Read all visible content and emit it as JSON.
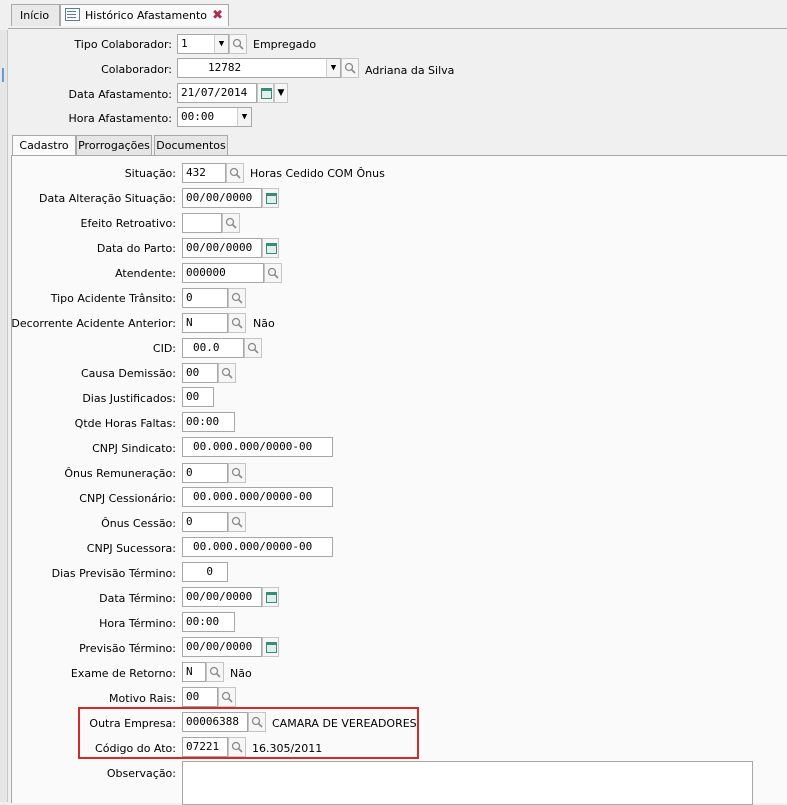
{
  "tabs": {
    "home": "Início",
    "current": "Histórico Afastamento"
  },
  "header": {
    "tipo_colaborador": {
      "label": "Tipo Colaborador:",
      "value": "1",
      "desc": "Empregado"
    },
    "colaborador": {
      "label": "Colaborador:",
      "value": "12782",
      "desc": "Adriana da Silva"
    },
    "data_afastamento": {
      "label": "Data Afastamento:",
      "value": "21/07/2014"
    },
    "hora_afastamento": {
      "label": "Hora Afastamento:",
      "value": "00:00"
    }
  },
  "subtabs": [
    "Cadastro",
    "Prorrogações",
    "Documentos"
  ],
  "form": {
    "situacao": {
      "label": "Situação:",
      "value": "432",
      "desc": "Horas Cedido COM Ônus"
    },
    "data_alteracao_situacao": {
      "label": "Data Alteração Situação:",
      "value": "00/00/0000"
    },
    "efeito_retroativo": {
      "label": "Efeito Retroativo:",
      "value": ""
    },
    "data_parto": {
      "label": "Data do Parto:",
      "value": "00/00/0000"
    },
    "atendente": {
      "label": "Atendente:",
      "value": "000000"
    },
    "tipo_acidente_transito": {
      "label": "Tipo Acidente Trânsito:",
      "value": "0"
    },
    "decorrente_acidente_anterior": {
      "label": "Decorrente Acidente Anterior:",
      "value": "N",
      "desc": "Não"
    },
    "cid": {
      "label": "CID:",
      "value": "00.0"
    },
    "causa_demissao": {
      "label": "Causa Demissão:",
      "value": "00"
    },
    "dias_justificados": {
      "label": "Dias Justificados:",
      "value": "00"
    },
    "qtde_horas_faltas": {
      "label": "Qtde Horas Faltas:",
      "value": "00:00"
    },
    "cnpj_sindicato": {
      "label": "CNPJ Sindicato:",
      "value": "00.000.000/0000-00"
    },
    "onus_remuneracao": {
      "label": "Ônus Remuneração:",
      "value": "0"
    },
    "cnpj_cessionario": {
      "label": "CNPJ Cessionário:",
      "value": "00.000.000/0000-00"
    },
    "onus_cessao": {
      "label": "Ônus Cessão:",
      "value": "0"
    },
    "cnpj_sucessora": {
      "label": "CNPJ Sucessora:",
      "value": "00.000.000/0000-00"
    },
    "dias_previsao_termino": {
      "label": "Dias Previsão Término:",
      "value": "0"
    },
    "data_termino": {
      "label": "Data Término:",
      "value": "00/00/0000"
    },
    "hora_termino": {
      "label": "Hora Término:",
      "value": "00:00"
    },
    "previsao_termino": {
      "label": "Previsão Término:",
      "value": "00/00/0000"
    },
    "exame_retorno": {
      "label": "Exame de Retorno:",
      "value": "N",
      "desc": "Não"
    },
    "motivo_rais": {
      "label": "Motivo Rais:",
      "value": "00"
    },
    "outra_empresa": {
      "label": "Outra Empresa:",
      "value": "00006388",
      "desc": "CAMARA DE VEREADORES"
    },
    "codigo_ato": {
      "label": "Código do Ato:",
      "value": "07221",
      "desc": "16.305/2011"
    },
    "observacao": {
      "label": "Observação:"
    }
  },
  "colors": {
    "highlight": "#d12a2a",
    "close_icon": "#b02a4a"
  }
}
